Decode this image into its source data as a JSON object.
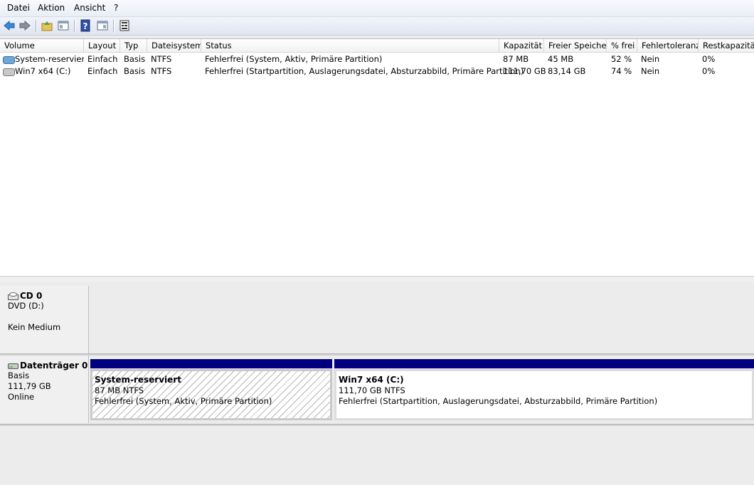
{
  "menu": [
    "Datei",
    "Aktion",
    "Ansicht",
    "?"
  ],
  "toolbar": {
    "buttons": [
      "back-icon",
      "forward-icon",
      "folder-up-icon",
      "show-hide-tree-icon",
      "help-icon",
      "show-hide-action-pane-icon",
      "properties-icon"
    ]
  },
  "columns": [
    "Volume",
    "Layout",
    "Typ",
    "Dateisystem",
    "Status",
    "Kapazität",
    "Freier Speicher",
    "% frei",
    "Fehlertoleranz",
    "Restkapazität"
  ],
  "volumes": [
    {
      "volume": "System-reserviert",
      "layout": "Einfach",
      "typ": "Basis",
      "dateisystem": "NTFS",
      "status": "Fehlerfrei (System, Aktiv, Primäre Partition)",
      "kapazitaet": "87 MB",
      "frei": "45 MB",
      "prozent": "52 %",
      "fehlertoleranz": "Nein",
      "rest": "0%"
    },
    {
      "volume": "Win7 x64 (C:)",
      "layout": "Einfach",
      "typ": "Basis",
      "dateisystem": "NTFS",
      "status": "Fehlerfrei (Startpartition, Auslagerungsdatei, Absturzabbild, Primäre Partition)",
      "kapazitaet": "111,70 GB",
      "frei": "83,14 GB",
      "prozent": "74 %",
      "fehlertoleranz": "Nein",
      "rest": "0%"
    }
  ],
  "cd": {
    "title": "CD 0",
    "drive": "DVD (D:)",
    "media": "Kein Medium"
  },
  "disk0": {
    "title": "Datenträger 0",
    "type": "Basis",
    "size": "111,79 GB",
    "state": "Online",
    "partitions": [
      {
        "name": "System-reserviert",
        "size": "87 MB NTFS",
        "status": "Fehlerfrei (System, Aktiv, Primäre Partition)"
      },
      {
        "name": "Win7 x64  (C:)",
        "size": "111,70 GB NTFS",
        "status": "Fehlerfrei (Startpartition, Auslagerungsdatei, Absturzabbild, Primäre Partition)"
      }
    ]
  },
  "colors": {
    "partition_header": "#000080",
    "system_volume_icon": "#6fa6d8",
    "c_volume_icon": "#c8c8c8"
  }
}
